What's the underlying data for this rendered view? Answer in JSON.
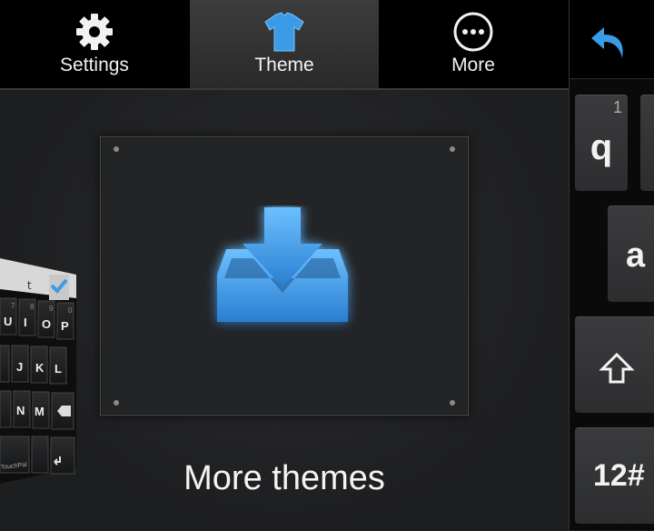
{
  "tabs": {
    "settings_label": "Settings",
    "theme_label": "Theme",
    "more_label": "More"
  },
  "main": {
    "more_themes_label": "More themes"
  },
  "preview": {
    "row1": [
      "U",
      "I",
      "O",
      "P"
    ],
    "row1_sub": [
      "7",
      "8",
      "9",
      "0"
    ],
    "row2": [
      "J",
      "K",
      "L"
    ],
    "row3": [
      "N",
      "M"
    ],
    "brand": "TouchPal"
  },
  "keyboard": {
    "q_label": "q",
    "q_sub": "1",
    "a_label": "a",
    "num_label": "12#"
  },
  "colors": {
    "accent": "#3a9be6",
    "icon_glow": "#4aa8ff"
  }
}
